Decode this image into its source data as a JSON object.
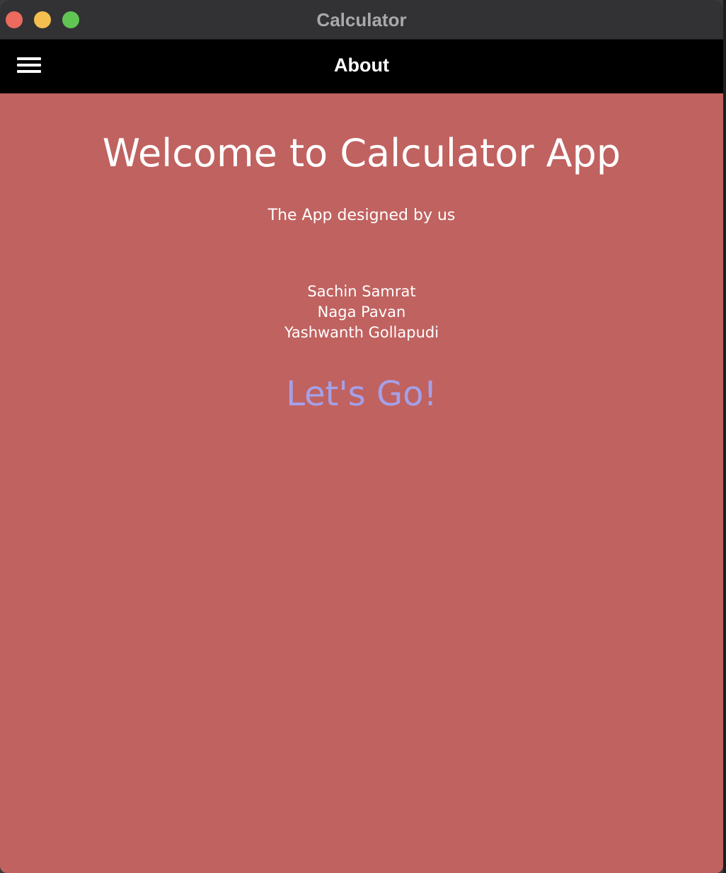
{
  "window": {
    "title": "Calculator"
  },
  "appbar": {
    "title": "About",
    "menu_icon": "hamburger-menu-icon"
  },
  "about": {
    "heading": "Welcome to Calculator App",
    "subtitle": "The App designed by us",
    "team": [
      "Sachin Samrat",
      "Naga Pavan",
      "Yashwanth Gollapudi"
    ],
    "cta": "Let's Go!"
  },
  "colors": {
    "titlebar": "#323234",
    "appbar": "#000000",
    "background": "#c06260",
    "text": "#ffffff",
    "cta": "#a5a0e8",
    "close": "#ec6a5e",
    "minimize": "#f4bf4f",
    "maximize": "#61c554"
  }
}
